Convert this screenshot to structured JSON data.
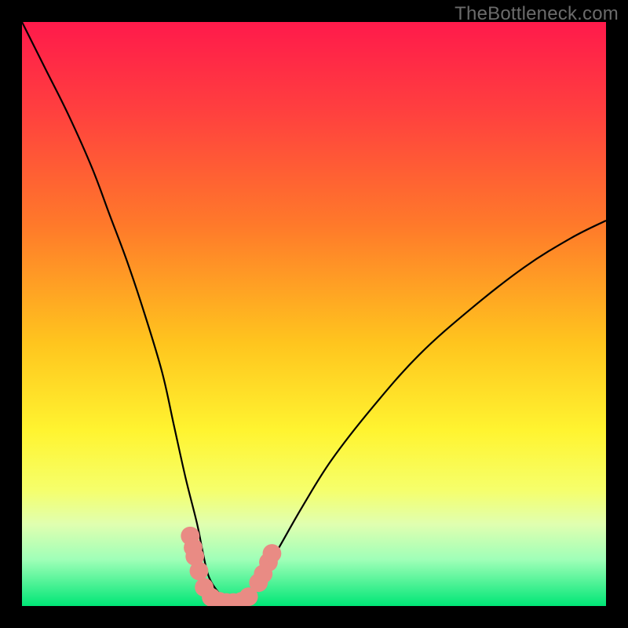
{
  "watermark": "TheBottleneck.com",
  "chart_data": {
    "type": "line",
    "title": "",
    "xlabel": "",
    "ylabel": "",
    "xlim": [
      0,
      100
    ],
    "ylim": [
      0,
      100
    ],
    "grid": false,
    "legend": false,
    "background_gradient": {
      "stops": [
        {
          "pct": 0,
          "color": "#ff1a4b"
        },
        {
          "pct": 15,
          "color": "#ff3f3f"
        },
        {
          "pct": 35,
          "color": "#ff7a2a"
        },
        {
          "pct": 55,
          "color": "#ffc51e"
        },
        {
          "pct": 70,
          "color": "#fff430"
        },
        {
          "pct": 80,
          "color": "#f6ff6a"
        },
        {
          "pct": 86,
          "color": "#e0ffb0"
        },
        {
          "pct": 92,
          "color": "#a0ffb8"
        },
        {
          "pct": 100,
          "color": "#00e676"
        }
      ]
    },
    "series": [
      {
        "name": "bottleneck-curve",
        "color": "#000000",
        "x": [
          0,
          4,
          8,
          12,
          15,
          18,
          21,
          24,
          26,
          28,
          30,
          31,
          32,
          33.5,
          35,
          37,
          39,
          41,
          44,
          48,
          53,
          60,
          68,
          77,
          86,
          94,
          100
        ],
        "y": [
          100,
          92,
          84,
          75,
          67,
          59,
          50,
          40,
          31,
          22,
          14,
          9,
          5,
          2.5,
          1,
          1,
          2.5,
          5,
          10,
          17,
          25,
          34,
          43,
          51,
          58,
          63,
          66
        ]
      }
    ],
    "markers": {
      "name": "highlight-dots",
      "color": "#e98b84",
      "radius": 1.6,
      "points": [
        {
          "x": 28.8,
          "y": 12.0
        },
        {
          "x": 29.3,
          "y": 10.0
        },
        {
          "x": 29.6,
          "y": 8.5
        },
        {
          "x": 30.3,
          "y": 6.0
        },
        {
          "x": 31.2,
          "y": 3.2
        },
        {
          "x": 32.4,
          "y": 1.5
        },
        {
          "x": 33.8,
          "y": 0.8
        },
        {
          "x": 35.0,
          "y": 0.6
        },
        {
          "x": 36.2,
          "y": 0.6
        },
        {
          "x": 37.6,
          "y": 0.8
        },
        {
          "x": 38.8,
          "y": 1.6
        },
        {
          "x": 40.5,
          "y": 4.0
        },
        {
          "x": 41.3,
          "y": 5.5
        },
        {
          "x": 42.2,
          "y": 7.5
        },
        {
          "x": 42.8,
          "y": 9.0
        }
      ]
    }
  }
}
